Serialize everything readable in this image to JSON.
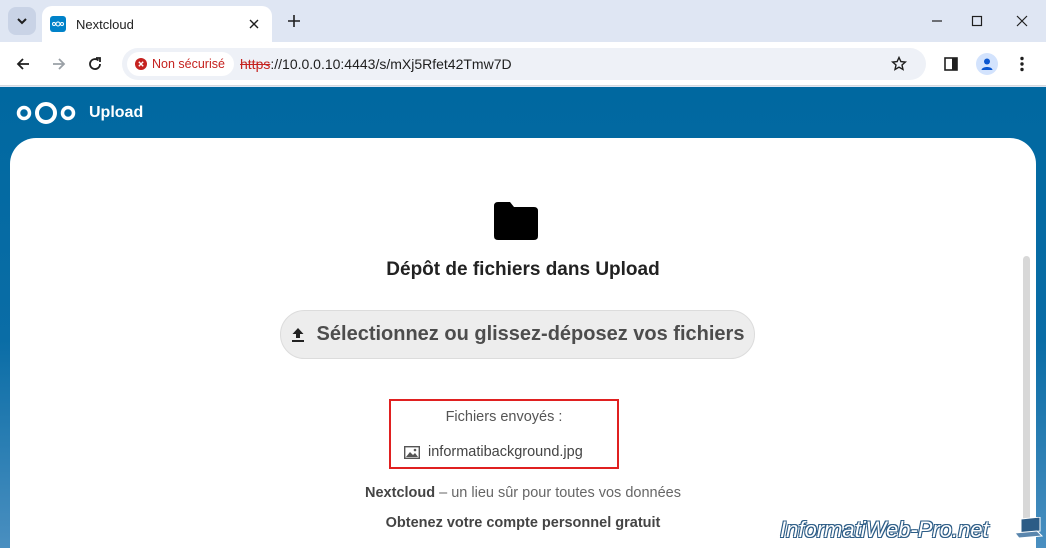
{
  "browser": {
    "tab_title": "Nextcloud",
    "security_label": "Non sécurisé",
    "url_scheme": "https",
    "url_rest": "://10.0.0.10:4443/s/mXj5Rfet42Tmw7D"
  },
  "app": {
    "header_title": "Upload",
    "drop_title": "Dépôt de fichiers dans Upload",
    "upload_button_label": "Sélectionnez ou glissez-déposez vos fichiers",
    "uploaded_files_title": "Fichiers envoyés :",
    "uploaded_files": [
      "informatibackground.jpg"
    ],
    "footer_brand": "Nextcloud",
    "footer_tagline": " – un lieu sûr pour toutes vos données",
    "footer_link": "Obtenez votre compte personnel gratuit"
  },
  "watermark": "InformatiWeb-Pro.net",
  "colors": {
    "nextcloud_blue": "#0068a0",
    "highlight_red": "#e02020",
    "insecure_red": "#c5221f"
  }
}
